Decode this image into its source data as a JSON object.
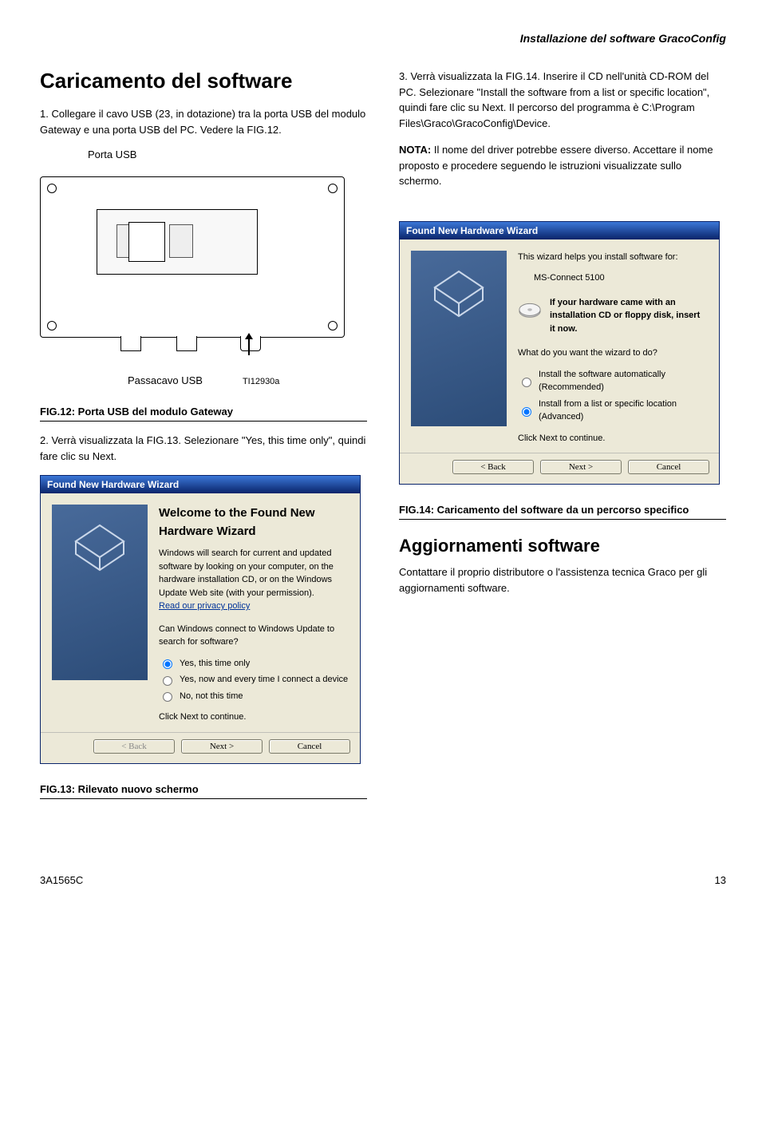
{
  "header": {
    "breadcrumb": "Installazione del software GracoConfig"
  },
  "left": {
    "section_title": "Caricamento del software",
    "step1": "1.   Collegare il cavo USB (23, in dotazione) tra la porta USB del modulo Gateway e una porta USB del PC. Vedere la FIG.12.",
    "porta_label": "Porta USB",
    "passacavo_label": "Passacavo USB",
    "ti_code": "TI12930a",
    "fig12": "FIG.12: Porta USB del modulo Gateway",
    "step2": "2.   Verrà visualizzata la FIG.13. Selezionare \"Yes, this time only\", quindi fare clic su Next.",
    "wizard1": {
      "title": "Found New Hardware Wizard",
      "welcome": "Welcome to the Found New Hardware Wizard",
      "line1": "Windows will search for current and updated software by looking on your computer, on the hardware installation CD, or on the Windows Update Web site (with your permission).",
      "privacy": "Read our privacy policy",
      "question": "Can Windows connect to Windows Update to search for software?",
      "opt1": "Yes, this time only",
      "opt2": "Yes, now and every time I connect a device",
      "opt3": "No, not this time",
      "continue": "Click Next to continue.",
      "btn_back": "< Back",
      "btn_next": "Next >",
      "btn_cancel": "Cancel"
    },
    "fig13": "FIG.13: Rilevato nuovo schermo"
  },
  "right": {
    "step3": "3.   Verrà visualizzata la FIG.14. Inserire il CD nell'unità CD-ROM del PC. Selezionare \"Install the software from a list or specific location\", quindi fare clic su Next. Il percorso del programma è C:\\Program Files\\Graco\\GracoConfig\\Device.",
    "nota": "NOTA: Il nome del driver potrebbe essere diverso. Accettare il nome proposto e procedere seguendo le istruzioni visualizzate sullo schermo.",
    "wizard2": {
      "title": "Found New Hardware Wizard",
      "help_line": "This wizard helps you install software for:",
      "device": "MS-Connect 5100",
      "cd_text": "If your hardware came with an installation CD or floppy disk, insert it now.",
      "question": "What do you want the wizard to do?",
      "opt1": "Install the software automatically (Recommended)",
      "opt2": "Install from a list or specific location (Advanced)",
      "continue": "Click Next to continue.",
      "btn_back": "< Back",
      "btn_next": "Next >",
      "btn_cancel": "Cancel"
    },
    "fig14": "FIG.14: Caricamento del software da un percorso specifico",
    "agg_title": "Aggiornamenti software",
    "agg_text": "Contattare il proprio distributore o l'assistenza tecnica Graco per gli aggiornamenti software."
  },
  "footer": {
    "docnum": "3A1565C",
    "page": "13"
  }
}
